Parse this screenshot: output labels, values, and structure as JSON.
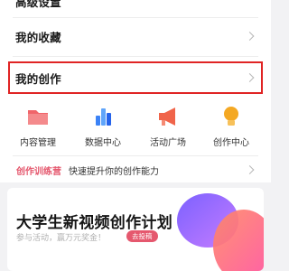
{
  "menu": {
    "top_partial_label": "高级设置",
    "favorites_label": "我的收藏",
    "creation_label": "我的创作"
  },
  "grid_items": [
    {
      "label": "内容管理",
      "icon": "folder-icon"
    },
    {
      "label": "数据中心",
      "icon": "data-chart-icon"
    },
    {
      "label": "活动广场",
      "icon": "megaphone-icon"
    },
    {
      "label": "创作中心",
      "icon": "lightbulb-icon"
    }
  ],
  "training": {
    "tag": "创作训练营",
    "desc": "快速提升你的创作能力"
  },
  "banner": {
    "title": "大学生新视频创作计划",
    "subtitle": "参与活动，赢万元奖金！",
    "button_label": "去投稿"
  },
  "colors": {
    "highlight": "#e02424",
    "accent": "#e5586e",
    "folder": "#f0656a",
    "data": "#3b82f6",
    "megaphone": "#f0644a",
    "bulb": "#f4a823"
  }
}
